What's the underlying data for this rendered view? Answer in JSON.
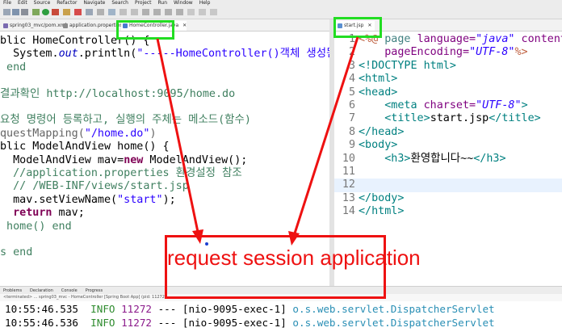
{
  "menubar": [
    "File",
    "Edit",
    "Source",
    "Refactor",
    "Navigate",
    "Search",
    "Project",
    "Run",
    "Window",
    "Help"
  ],
  "left_editor": {
    "tabs": [
      {
        "label": "spring03_mvc/pom.xml",
        "icon": "xml-file-icon"
      },
      {
        "label": "application.properties",
        "icon": "properties-file-icon"
      },
      {
        "label": "HomeController.java",
        "icon": "java-file-icon",
        "active": true
      }
    ],
    "lines": [
      [
        {
          "t": "blic HomeController() {",
          "c": "#000000"
        }
      ],
      [
        {
          "t": "  System.",
          "c": "#000000"
        },
        {
          "t": "out",
          "c": "#0000c0",
          "i": true
        },
        {
          "t": ".println(",
          "c": "#000000"
        },
        {
          "t": "\"-----HomeController()객체 생성됨\"",
          "c": "#2a00ff"
        }
      ],
      [
        {
          "t": " end",
          "c": "#3f7f5f"
        }
      ],
      [
        {
          "t": "",
          "c": "#000000"
        }
      ],
      [
        {
          "t": "결과확인 http://localhost:9095/home.do",
          "c": "#3f7f5f"
        }
      ],
      [
        {
          "t": "",
          "c": "#000000"
        }
      ],
      [
        {
          "t": "요청 명령어 등록하고, 실행의 주체는 메소드(함수)",
          "c": "#3f7f5f"
        }
      ],
      [
        {
          "t": "questMapping(",
          "c": "#646464"
        },
        {
          "t": "\"/home.do\"",
          "c": "#2a00ff"
        },
        {
          "t": ")",
          "c": "#646464"
        }
      ],
      [
        {
          "t": "blic ModelAndView home() {",
          "c": "#000000"
        }
      ],
      [
        {
          "t": "  ModelAndView mav=",
          "c": "#000000"
        },
        {
          "t": "new",
          "c": "#7f0055",
          "b": true
        },
        {
          "t": " ModelAndView();",
          "c": "#000000"
        }
      ],
      [
        {
          "t": "  //application.properties 환경설정 참조",
          "c": "#3f7f5f"
        }
      ],
      [
        {
          "t": "  // /WEB-INF/views/start.jsp",
          "c": "#3f7f5f"
        }
      ],
      [
        {
          "t": "  mav.setViewName(",
          "c": "#000000"
        },
        {
          "t": "\"start\"",
          "c": "#2a00ff"
        },
        {
          "t": ");",
          "c": "#000000"
        }
      ],
      [
        {
          "t": "  ",
          "c": "#000000"
        },
        {
          "t": "return",
          "c": "#7f0055",
          "b": true
        },
        {
          "t": " mav;",
          "c": "#000000"
        }
      ],
      [
        {
          "t": " home() end",
          "c": "#3f7f5f"
        }
      ],
      [
        {
          "t": "",
          "c": "#000000"
        }
      ],
      [
        {
          "t": "s end",
          "c": "#3f7f5f"
        }
      ]
    ]
  },
  "right_editor": {
    "tab": {
      "label": "start.jsp",
      "icon": "jsp-file-icon",
      "active": true
    },
    "lines": [
      {
        "n": "1",
        "segs": [
          {
            "t": "<%@ ",
            "c": "#bf5f3f"
          },
          {
            "t": "page ",
            "c": "#3f7f7f"
          },
          {
            "t": "language=",
            "c": "#7f007f"
          },
          {
            "t": "\"java\"",
            "c": "#2a00ff",
            "i": true
          },
          {
            "t": " contentType",
            "c": "#7f007f"
          }
        ]
      },
      {
        "n": "2",
        "segs": [
          {
            "t": "    pageEncoding=",
            "c": "#7f007f"
          },
          {
            "t": "\"UTF-8\"",
            "c": "#2a00ff",
            "i": true
          },
          {
            "t": "%>",
            "c": "#bf5f3f"
          }
        ]
      },
      {
        "n": "3",
        "segs": [
          {
            "t": "<!DOCTYPE html>",
            "c": "#008080"
          }
        ]
      },
      {
        "n": "4",
        "segs": [
          {
            "t": "<html>",
            "c": "#008080"
          }
        ]
      },
      {
        "n": "5",
        "segs": [
          {
            "t": "<head>",
            "c": "#008080"
          }
        ]
      },
      {
        "n": "6",
        "segs": [
          {
            "t": "    <meta ",
            "c": "#008080"
          },
          {
            "t": "charset=",
            "c": "#7f007f"
          },
          {
            "t": "\"UTF-8\"",
            "c": "#2a00ff",
            "i": true
          },
          {
            "t": ">",
            "c": "#008080"
          }
        ]
      },
      {
        "n": "7",
        "segs": [
          {
            "t": "    <title>",
            "c": "#008080"
          },
          {
            "t": "start.jsp",
            "c": "#000000"
          },
          {
            "t": "</title>",
            "c": "#008080"
          }
        ]
      },
      {
        "n": "8",
        "segs": [
          {
            "t": "</head>",
            "c": "#008080"
          }
        ]
      },
      {
        "n": "9",
        "segs": [
          {
            "t": "<body>",
            "c": "#008080"
          }
        ]
      },
      {
        "n": "10",
        "segs": [
          {
            "t": "    <h3>",
            "c": "#008080"
          },
          {
            "t": "환영합니다~~",
            "c": "#000000"
          },
          {
            "t": "</h3>",
            "c": "#008080"
          }
        ]
      },
      {
        "n": "11",
        "segs": [
          {
            "t": "",
            "c": "#000000"
          }
        ]
      },
      {
        "n": "12",
        "segs": [
          {
            "t": "",
            "c": "#000000"
          }
        ],
        "current": true
      },
      {
        "n": "13",
        "segs": [
          {
            "t": "</body>",
            "c": "#008080"
          }
        ]
      },
      {
        "n": "14",
        "segs": [
          {
            "t": "</html>",
            "c": "#008080"
          }
        ]
      }
    ]
  },
  "console": {
    "tabs": [
      "Problems",
      "Declaration",
      "Console",
      "Progress"
    ],
    "header": "<terminated> ... spring03_mvc - HomeController [Spring Boot App] (pid: 11272)",
    "lines": [
      {
        "time": "10:55:46.535",
        "level": "INFO",
        "pid": "11272",
        "sep": "---",
        "thread": "[nio-9095-exec-1]",
        "logger": "o.s.web.servlet.DispatcherServlet"
      },
      {
        "time": "10:55:46.536",
        "level": "INFO",
        "pid": "11272",
        "sep": "---",
        "thread": "[nio-9095-exec-1]",
        "logger": "o.s.web.servlet.DispatcherServlet"
      }
    ]
  },
  "annotation": {
    "caption": "request session application",
    "box_color": "#ee1111",
    "highlight_color": "#22dd22"
  }
}
